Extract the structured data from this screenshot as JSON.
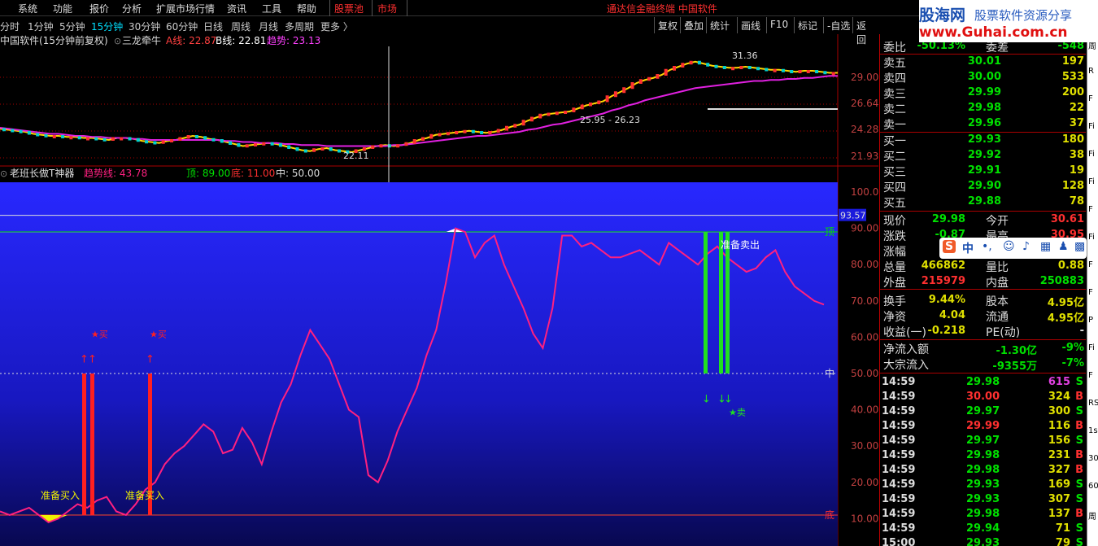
{
  "menu": {
    "items": [
      "系统",
      "功能",
      "报价",
      "分析",
      "扩展市场行情",
      "资讯",
      "工具",
      "帮助"
    ],
    "stock_pool": "股票池",
    "market": "市场",
    "title": "通达信金融终端  中国软件"
  },
  "periods": {
    "items": [
      "分时",
      "1分钟",
      "5分钟",
      "15分钟",
      "30分钟",
      "60分钟",
      "日线",
      "周线",
      "月线",
      "多周期",
      "更多 〉"
    ],
    "active_index": 3
  },
  "toolbar": {
    "items": [
      "复权",
      "叠加",
      "统计",
      "画线",
      "F10",
      "标记",
      "-自选",
      "返回"
    ]
  },
  "main_chart": {
    "title": "中国软件(15分钟前复权)",
    "indicator": "三龙牵牛",
    "a_label": "A线: 22.87",
    "b_label": "B线: 22.81",
    "trend_label": "趋势: 23.13",
    "price_ticks": [
      "29.00",
      "26.64",
      "24.28",
      "21.93"
    ],
    "annot_high": "31.36",
    "annot_low": "22.11",
    "annot_range": "25.95 - 26.23"
  },
  "sub_chart": {
    "name": "老班长做T神器",
    "trend_label": "趋势线: 43.78",
    "top_label": "顶: 89.00",
    "bottom_label": "底: 11.00",
    "mid_label": "中: 50.00",
    "axis_ticks": [
      "100.00",
      "90.00",
      "80.00",
      "70.00",
      "60.00",
      "50.00",
      "40.00",
      "30.00",
      "20.00",
      "10.00"
    ],
    "current_value": "93.57",
    "line_labels": {
      "top": "顶",
      "mid": "中",
      "bottom": "底"
    },
    "buy_text": "准备买入",
    "sell_text": "准备卖出",
    "buy_star": "★买",
    "sell_star": "★卖"
  },
  "chart_data": {
    "type": "line",
    "title": "老班长做T神器",
    "ylim": [
      0,
      100
    ],
    "series": [
      {
        "name": "趋势线",
        "values": [
          12,
          11,
          12,
          13,
          11,
          9,
          10,
          12,
          14,
          13,
          15,
          16,
          12,
          11,
          14,
          18,
          20,
          25,
          28,
          30,
          33,
          36,
          34,
          28,
          29,
          35,
          31,
          25,
          34,
          42,
          47,
          55,
          62,
          58,
          54,
          47,
          40,
          38,
          22,
          20,
          26,
          34,
          40,
          46,
          55,
          62,
          75,
          90,
          89,
          82,
          86,
          88,
          80,
          74,
          68,
          61,
          57,
          68,
          88,
          88,
          85,
          86,
          84,
          82,
          82,
          83,
          84,
          82,
          80,
          86,
          84,
          82,
          80,
          83,
          85,
          82,
          80,
          78,
          79,
          82,
          84,
          78,
          74,
          72,
          70,
          69
        ]
      },
      {
        "name": "顶",
        "values": [
          89
        ]
      },
      {
        "name": "中",
        "values": [
          50
        ]
      },
      {
        "name": "底",
        "values": [
          11
        ]
      }
    ]
  },
  "quote": {
    "header": {
      "label": "委比",
      "value": "-50.13%",
      "label2": "委差",
      "value2": "-548"
    },
    "asks": [
      {
        "label": "卖五",
        "price": "30.01",
        "vol": "197"
      },
      {
        "label": "卖四",
        "price": "30.00",
        "vol": "533"
      },
      {
        "label": "卖三",
        "price": "29.99",
        "vol": "200"
      },
      {
        "label": "卖二",
        "price": "29.98",
        "vol": "22"
      },
      {
        "label": "卖一",
        "price": "29.96",
        "vol": "37"
      }
    ],
    "bids": [
      {
        "label": "买一",
        "price": "29.93",
        "vol": "180"
      },
      {
        "label": "买二",
        "price": "29.92",
        "vol": "38"
      },
      {
        "label": "买三",
        "price": "29.91",
        "vol": "19"
      },
      {
        "label": "买四",
        "price": "29.90",
        "vol": "128"
      },
      {
        "label": "买五",
        "price": "29.88",
        "vol": "78"
      }
    ],
    "stats": [
      {
        "l1": "现价",
        "v1": "29.98",
        "l2": "今开",
        "v2": "30.61"
      },
      {
        "l1": "涨跌",
        "v1": "-0.87",
        "l2": "最高",
        "v2": "30.95"
      },
      {
        "l1": "涨幅",
        "v1": "",
        "l2": "",
        "v2": ""
      },
      {
        "l1": "总量",
        "v1": "466862",
        "l2": "量比",
        "v2": "0.88"
      },
      {
        "l1": "外盘",
        "v1": "215979",
        "l2": "内盘",
        "v2": "250883"
      },
      {
        "l1": "换手",
        "v1": "9.44%",
        "l2": "股本",
        "v2": "4.95亿"
      },
      {
        "l1": "净资",
        "v1": "4.04",
        "l2": "流通",
        "v2": "4.95亿"
      },
      {
        "l1": "收益(一)",
        "v1": "-0.218",
        "l2": "PE(动)",
        "v2": "-"
      }
    ],
    "flows": [
      {
        "l": "净流入额",
        "v": "-1.30亿",
        "p": "-9%"
      },
      {
        "l": "大宗流入",
        "v": "-9355万",
        "p": "-7%"
      }
    ],
    "ticks": [
      {
        "t": "14:59",
        "p": "29.98",
        "q": "615",
        "s": "S"
      },
      {
        "t": "14:59",
        "p": "30.00",
        "q": "324",
        "s": "B"
      },
      {
        "t": "14:59",
        "p": "29.97",
        "q": "300",
        "s": "S"
      },
      {
        "t": "14:59",
        "p": "29.99",
        "q": "116",
        "s": "B"
      },
      {
        "t": "14:59",
        "p": "29.97",
        "q": "156",
        "s": "S"
      },
      {
        "t": "14:59",
        "p": "29.98",
        "q": "231",
        "s": "B"
      },
      {
        "t": "14:59",
        "p": "29.98",
        "q": "327",
        "s": "B"
      },
      {
        "t": "14:59",
        "p": "29.93",
        "q": "169",
        "s": "S"
      },
      {
        "t": "14:59",
        "p": "29.93",
        "q": "307",
        "s": "S"
      },
      {
        "t": "14:59",
        "p": "29.98",
        "q": "137",
        "s": "B"
      },
      {
        "t": "14:59",
        "p": "29.94",
        "q": "71",
        "s": "S"
      },
      {
        "t": "15:00",
        "p": "29.93",
        "q": "79",
        "s": "S"
      }
    ]
  },
  "logo": {
    "brand": "股海网",
    "slogan": "股票软件资源分享",
    "url": "www.Guhai.com.cn"
  },
  "ime": {
    "mode": "中"
  },
  "strip": [
    "周",
    "R",
    "F",
    "Fi",
    "Fi",
    "Fi",
    "F",
    "Fi",
    "F",
    "F",
    "P",
    "Fi",
    "F",
    "RS",
    "1s",
    "30",
    "60",
    "周"
  ],
  "colors": {
    "up": "#ff3030",
    "down": "#00e000",
    "flat": "#e8e8e8",
    "sub_bg": "#1a1adc",
    "trend": "#ff2080",
    "label_yellow": "#f0f000"
  }
}
